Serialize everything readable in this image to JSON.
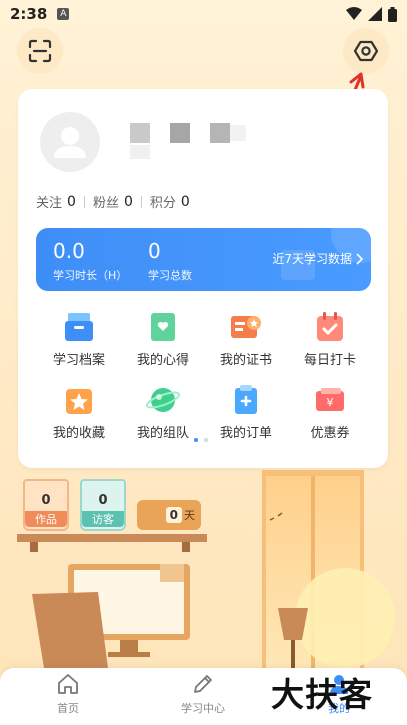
{
  "status_bar": {
    "time": "2:38",
    "notification_letter": "A"
  },
  "header": {
    "scan_icon": "scan-icon",
    "settings_icon": "settings-hexagon-icon"
  },
  "profile": {
    "stats": [
      {
        "label": "关注",
        "value": "0"
      },
      {
        "label": "粉丝",
        "value": "0"
      },
      {
        "label": "积分",
        "value": "0"
      }
    ]
  },
  "study": {
    "duration_value": "0.0",
    "duration_label": "学习时长（H）",
    "total_value": "0",
    "total_label": "学习总数",
    "link_label": "近7天学习数据"
  },
  "grid": {
    "items": [
      {
        "label": "学习档案",
        "icon": "archive-icon"
      },
      {
        "label": "我的心得",
        "icon": "notes-icon"
      },
      {
        "label": "我的证书",
        "icon": "certificate-icon"
      },
      {
        "label": "每日打卡",
        "icon": "calendar-checkin-icon"
      },
      {
        "label": "我的收藏",
        "icon": "favorites-icon"
      },
      {
        "label": "我的组队",
        "icon": "team-planet-icon"
      },
      {
        "label": "我的订单",
        "icon": "order-icon"
      },
      {
        "label": "优惠券",
        "icon": "coupon-icon"
      }
    ]
  },
  "scene": {
    "works": {
      "count": "0",
      "label": "作品"
    },
    "visitors": {
      "count": "0",
      "label": "访客"
    },
    "days": {
      "value": "0",
      "unit": "天"
    }
  },
  "tabbar": {
    "tabs": [
      {
        "label": "首页",
        "icon": "home-icon"
      },
      {
        "label": "学习中心",
        "icon": "pencil-icon"
      },
      {
        "label": "我的",
        "icon": "profile-icon"
      }
    ]
  },
  "watermark": "大扶客",
  "colors": {
    "accent": "#3e8ef7",
    "background": "#fff2d6"
  }
}
